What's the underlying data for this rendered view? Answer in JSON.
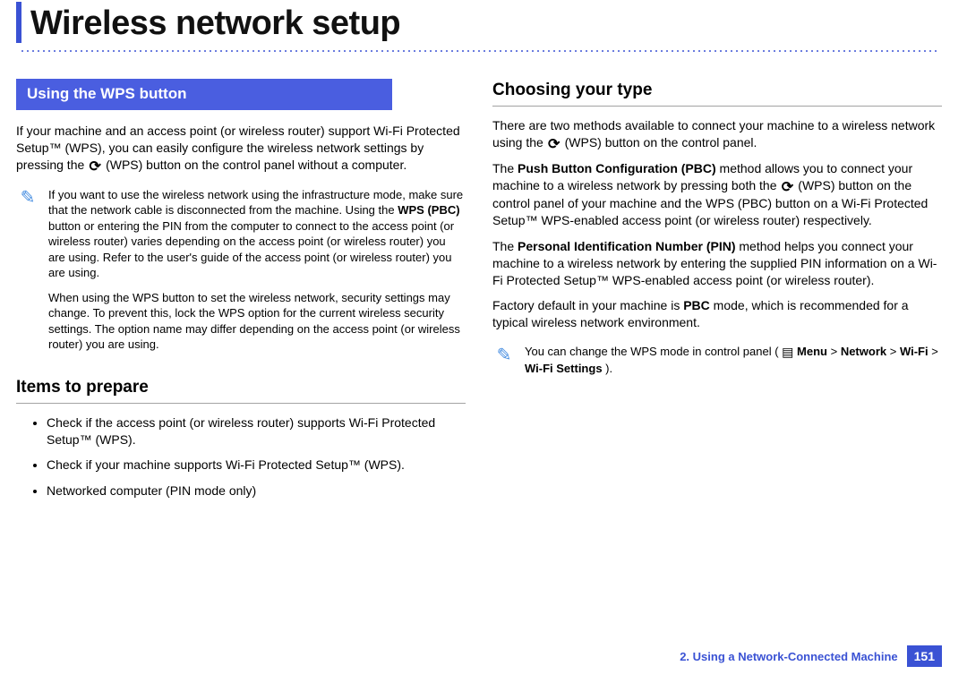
{
  "page_title": "Wireless network setup",
  "left": {
    "section_header": "Using the WPS button",
    "intro_a": "If your machine and an access point (or wireless router) support Wi-Fi Protected Setup™ (WPS), you can easily configure the wireless network settings by pressing the ",
    "intro_b": " (WPS) button on the control panel without a computer.",
    "note1_a": "If you want to use the wireless network using the infrastructure mode, make sure that the network cable is disconnected from the machine. Using the ",
    "note1_bold": "WPS (PBC)",
    "note1_b": " button or entering the PIN from the computer to connect to the access point (or wireless router) varies depending on the access point (or wireless router) you are using. Refer to the user's guide of the access point (or wireless router) you are using.",
    "note2": "When using the WPS button to set the wireless network, security settings may change. To prevent this, lock the WPS option for the current wireless security settings. The option name may differ depending on the access point (or wireless router) you are using.",
    "items_heading": "Items to prepare",
    "items": [
      "Check if the access point (or wireless router) supports Wi-Fi Protected Setup™ (WPS).",
      "Check if your machine supports Wi-Fi Protected Setup™ (WPS).",
      "Networked computer (PIN mode only)"
    ]
  },
  "right": {
    "heading": "Choosing your type",
    "p1_a": "There are two methods available to connect your machine to a wireless network using the ",
    "p1_b": " (WPS) button on the control panel.",
    "p2_a": "The ",
    "p2_bold": "Push Button Configuration (PBC)",
    "p2_b": " method allows you to connect your machine to a wireless network by pressing both the ",
    "p2_c": " (WPS) button on the control panel of your machine and the WPS (PBC) button on a Wi-Fi Protected Setup™ WPS-enabled access point (or wireless router) respectively.",
    "p3_a": "The ",
    "p3_bold": "Personal Identification Number (PIN)",
    "p3_b": " method helps you connect your machine to a wireless network by entering the supplied PIN information on a Wi-Fi Protected Setup™ WPS-enabled access point (or wireless router).",
    "p4_a": "Factory default in your machine is ",
    "p4_bold": "PBC",
    "p4_b": " mode, which is recommended for a typical wireless network environment.",
    "note_a": "You can change the WPS mode in control panel ( ",
    "note_menu": "Menu",
    "note_gt1": " > ",
    "note_network": "Network",
    "note_gt2": " > ",
    "note_wifi": "Wi-Fi",
    "note_gt3": " > ",
    "note_wifisettings": "Wi-Fi Settings",
    "note_b": ")."
  },
  "footer": {
    "chapter": "2.  Using a Network-Connected Machine",
    "page": "151"
  },
  "icons": {
    "wps": "⟳",
    "note": "✎",
    "menu": "▤"
  }
}
